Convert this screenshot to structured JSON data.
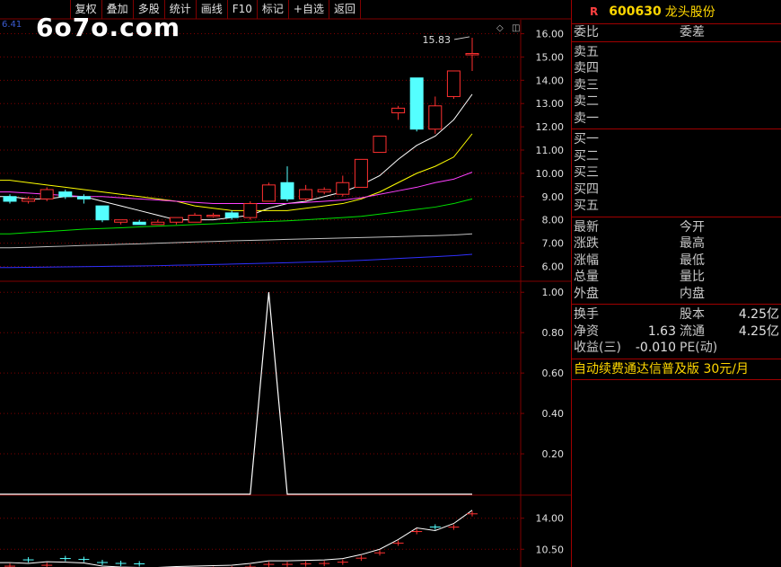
{
  "toolbar": [
    "复权",
    "叠加",
    "多股",
    "统计",
    "画线",
    "F10",
    "标记",
    "+自选",
    "返回"
  ],
  "logo": "6o7o.com",
  "corner_value": "6.41",
  "stock": {
    "r_mark": "R",
    "code": "600630",
    "name": "龙头股份"
  },
  "quote": {
    "wb_label": "委比",
    "wc_label": "委差",
    "sell": [
      "卖五",
      "卖四",
      "卖三",
      "卖二",
      "卖一"
    ],
    "buy": [
      "买一",
      "买二",
      "买三",
      "买四",
      "买五"
    ],
    "stats": [
      [
        "最新",
        "今开"
      ],
      [
        "涨跌",
        "最高"
      ],
      [
        "涨幅",
        "最低"
      ],
      [
        "总量",
        "量比"
      ],
      [
        "外盘",
        "内盘"
      ]
    ],
    "fin": [
      {
        "l1": "换手",
        "v1": "",
        "l2": "股本",
        "v2": "4.25亿"
      },
      {
        "l1": "净资",
        "v1": "1.63",
        "l2": "流通",
        "v2": "4.25亿"
      },
      {
        "l1": "收益(三)",
        "v1": "-0.010",
        "l2": "PE(动)",
        "v2": ""
      }
    ],
    "promo_text": "自动续费通达信普及版",
    "promo_price": "30元/月"
  },
  "colors": {
    "up": "#ff3030",
    "down": "#54ffff",
    "ma5": "#ffffff",
    "ma10": "#ffff00",
    "ma20": "#ff40ff",
    "ma30": "#00e000",
    "ma60": "#c0c0c0",
    "ma120": "#3030ff",
    "grid": "#800000",
    "axis_text": "#e0e0e0"
  },
  "chart_data": [
    {
      "type": "candlestick",
      "ylim": [
        5.4,
        16.6
      ],
      "yticks": [
        "16.00",
        "15.00",
        "14.00",
        "13.00",
        "12.00",
        "11.00",
        "10.00",
        "9.00",
        "8.00",
        "7.00",
        "6.00"
      ],
      "annotation": "15.83",
      "candles": [
        {
          "o": 9.0,
          "c": 8.8,
          "h": 9.1,
          "l": 8.7
        },
        {
          "o": 8.8,
          "c": 8.9,
          "h": 9.0,
          "l": 8.7
        },
        {
          "o": 8.9,
          "c": 9.3,
          "h": 9.4,
          "l": 8.8
        },
        {
          "o": 9.2,
          "c": 9.0,
          "h": 9.3,
          "l": 8.9
        },
        {
          "o": 9.0,
          "c": 8.9,
          "h": 9.1,
          "l": 8.7
        },
        {
          "o": 8.6,
          "c": 8.0,
          "h": 8.6,
          "l": 7.9
        },
        {
          "o": 7.9,
          "c": 8.0,
          "h": 8.0,
          "l": 7.8
        },
        {
          "o": 7.9,
          "c": 7.8,
          "h": 8.0,
          "l": 7.8
        },
        {
          "o": 7.8,
          "c": 7.9,
          "h": 8.0,
          "l": 7.8
        },
        {
          "o": 7.9,
          "c": 8.1,
          "h": 8.1,
          "l": 7.8
        },
        {
          "o": 7.9,
          "c": 8.2,
          "h": 8.3,
          "l": 7.9
        },
        {
          "o": 8.2,
          "c": 8.2,
          "h": 8.3,
          "l": 8.1
        },
        {
          "o": 8.3,
          "c": 8.1,
          "h": 8.4,
          "l": 8.0
        },
        {
          "o": 8.1,
          "c": 8.7,
          "h": 8.8,
          "l": 8.0
        },
        {
          "o": 8.8,
          "c": 9.5,
          "h": 9.6,
          "l": 8.8
        },
        {
          "o": 9.6,
          "c": 8.9,
          "h": 10.3,
          "l": 8.8
        },
        {
          "o": 8.9,
          "c": 9.3,
          "h": 9.5,
          "l": 8.8
        },
        {
          "o": 9.2,
          "c": 9.3,
          "h": 9.4,
          "l": 9.1
        },
        {
          "o": 9.1,
          "c": 9.6,
          "h": 9.9,
          "l": 9.0
        },
        {
          "o": 9.4,
          "c": 10.6,
          "h": 10.6,
          "l": 9.4
        },
        {
          "o": 10.9,
          "c": 11.6,
          "h": 11.6,
          "l": 10.9
        },
        {
          "o": 12.6,
          "c": 12.8,
          "h": 12.9,
          "l": 12.3
        },
        {
          "o": 14.1,
          "c": 11.9,
          "h": 14.1,
          "l": 11.8
        },
        {
          "o": 11.9,
          "c": 12.9,
          "h": 13.3,
          "l": 11.7
        },
        {
          "o": 13.3,
          "c": 14.4,
          "h": 14.4,
          "l": 13.2
        },
        {
          "o": 15.1,
          "c": 15.15,
          "h": 15.83,
          "l": 14.4
        }
      ],
      "ma": {
        "ma5": [
          9.0,
          8.9,
          8.9,
          9.0,
          9.0,
          8.8,
          8.6,
          8.4,
          8.2,
          8.0,
          8.0,
          8.0,
          8.1,
          8.2,
          8.5,
          8.7,
          8.8,
          9.0,
          9.2,
          9.5,
          9.9,
          10.6,
          11.2,
          11.6,
          12.3,
          13.4
        ],
        "ma10": [
          9.7,
          9.6,
          9.5,
          9.4,
          9.3,
          9.2,
          9.1,
          9.0,
          8.9,
          8.8,
          8.6,
          8.5,
          8.4,
          8.4,
          8.4,
          8.4,
          8.5,
          8.6,
          8.7,
          8.9,
          9.2,
          9.6,
          10.0,
          10.3,
          10.7,
          11.7
        ],
        "ma20": [
          9.2,
          9.15,
          9.1,
          9.05,
          9.0,
          9.0,
          8.95,
          8.9,
          8.85,
          8.8,
          8.75,
          8.7,
          8.7,
          8.7,
          8.7,
          8.7,
          8.75,
          8.8,
          8.85,
          8.95,
          9.1,
          9.25,
          9.4,
          9.6,
          9.75,
          10.05
        ],
        "ma30": [
          7.4,
          7.45,
          7.5,
          7.55,
          7.6,
          7.63,
          7.66,
          7.7,
          7.73,
          7.76,
          7.8,
          7.83,
          7.86,
          7.9,
          7.93,
          7.96,
          8.0,
          8.05,
          8.1,
          8.15,
          8.25,
          8.35,
          8.45,
          8.55,
          8.7,
          8.9
        ],
        "ma60": [
          6.8,
          6.82,
          6.85,
          6.87,
          6.9,
          6.92,
          6.95,
          6.97,
          7.0,
          7.02,
          7.05,
          7.07,
          7.1,
          7.12,
          7.14,
          7.16,
          7.18,
          7.2,
          7.22,
          7.24,
          7.26,
          7.28,
          7.3,
          7.32,
          7.35,
          7.4
        ],
        "ma120": [
          5.95,
          5.96,
          5.97,
          5.98,
          5.99,
          6.0,
          6.01,
          6.02,
          6.03,
          6.05,
          6.06,
          6.08,
          6.1,
          6.12,
          6.14,
          6.16,
          6.18,
          6.2,
          6.23,
          6.26,
          6.3,
          6.34,
          6.38,
          6.42,
          6.46,
          6.52
        ]
      }
    },
    {
      "type": "line",
      "ylim": [
        0,
        1.05
      ],
      "yticks": [
        "1.00",
        "0.80",
        "0.60",
        "0.40",
        "0.20"
      ],
      "values": [
        0,
        0,
        0,
        0,
        0,
        0,
        0,
        0,
        0,
        0,
        0,
        0,
        0,
        0,
        1,
        0,
        0,
        0,
        0,
        0,
        0,
        0,
        0,
        0,
        0,
        0
      ]
    },
    {
      "type": "candlestick",
      "ylim": [
        8.5,
        16.5
      ],
      "yticks": [
        "14.00",
        "10.50"
      ],
      "closes": [
        9.0,
        8.9,
        9.1,
        9.05,
        8.95,
        8.6,
        8.5,
        8.45,
        8.45,
        8.55,
        8.6,
        8.65,
        8.7,
        8.9,
        9.2,
        9.2,
        9.25,
        9.3,
        9.45,
        9.9,
        10.5,
        11.6,
        12.9,
        12.6,
        13.4,
        14.9
      ]
    }
  ]
}
